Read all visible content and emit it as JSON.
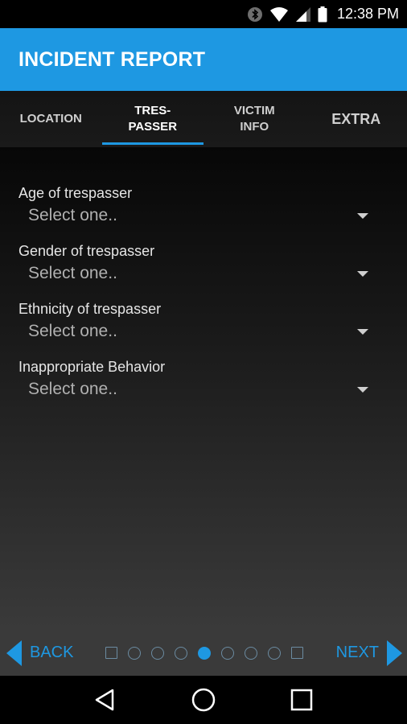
{
  "status_bar": {
    "time": "12:38 PM",
    "icons": [
      "bluetooth-icon",
      "wifi-icon",
      "signal-icon",
      "battery-icon"
    ]
  },
  "app_bar": {
    "title": "INCIDENT REPORT"
  },
  "tabs": [
    {
      "label": "LOCATION",
      "active": false
    },
    {
      "label": "TRES-\nPASSER",
      "active": true
    },
    {
      "label": "VICTIM\nINFO",
      "active": false
    },
    {
      "label": "EXTRA",
      "active": false
    }
  ],
  "form": {
    "fields": [
      {
        "label": "Age of trespasser",
        "value": "Select one.."
      },
      {
        "label": "Gender of trespasser",
        "value": "Select one.."
      },
      {
        "label": "Ethnicity of trespasser",
        "value": "Select one.."
      },
      {
        "label": "Inappropriate Behavior",
        "value": "Select one.."
      }
    ]
  },
  "pager": {
    "back_label": "BACK",
    "next_label": "NEXT",
    "current_page": 5,
    "total_pages": 9,
    "accent_color": "#1e98e2"
  },
  "nav_bar": {
    "icons": [
      "back-triangle-icon",
      "home-circle-icon",
      "recents-square-icon"
    ]
  },
  "colors": {
    "accent": "#1e98e2",
    "app_bar": "#1e98e2",
    "background": "#000000"
  }
}
